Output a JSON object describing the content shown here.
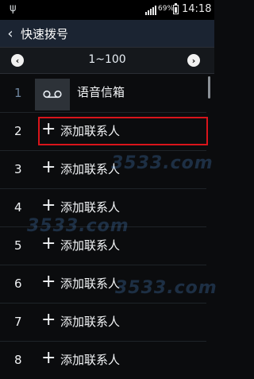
{
  "status_bar": {
    "battery_percent": "69%",
    "time": "14:18"
  },
  "app_bar": {
    "title": "快速拨号"
  },
  "pager": {
    "range": "1~100"
  },
  "voicemail": {
    "number": "1",
    "label": "语音信箱"
  },
  "rows": [
    {
      "number": "2",
      "label": "添加联系人"
    },
    {
      "number": "3",
      "label": "添加联系人"
    },
    {
      "number": "4",
      "label": "添加联系人"
    },
    {
      "number": "5",
      "label": "添加联系人"
    },
    {
      "number": "6",
      "label": "添加联系人"
    },
    {
      "number": "7",
      "label": "添加联系人"
    },
    {
      "number": "8",
      "label": "添加联系人"
    }
  ],
  "watermarks": [
    "3533.com",
    "3533.com",
    "3533.com"
  ],
  "icons": {
    "usb": "usb-icon",
    "signal": "signal-icon",
    "battery": "battery-icon",
    "back": "back-arrow-icon",
    "prev": "chevron-left-icon",
    "next": "chevron-right-icon",
    "voicemail": "voicemail-icon",
    "add": "plus-icon"
  },
  "colors": {
    "app_bar": "#1b2432",
    "highlight": "#d9141b",
    "background": "#0b0c0e"
  }
}
